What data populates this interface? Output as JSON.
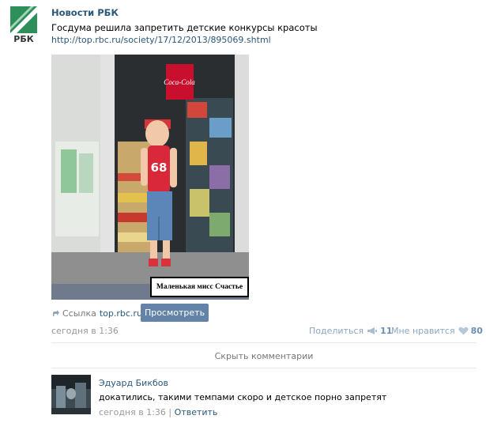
{
  "post": {
    "author": "Новости РБК",
    "logo_text": "РБК",
    "text": "Госдума решила запретить детские конкурсы красоты",
    "link": "http://top.rbc.ru/society/17/12/2013/895069.shtml",
    "photo_caption": "Маленькая мисс Счастье",
    "photo_sign": "Coca-Cola",
    "shirt_number": "68",
    "link_label": "Ссылка",
    "link_domain": "top.rbc.ru",
    "view_button": "Просмотреть",
    "time": "сегодня в 1:36",
    "share_label": "Поделиться",
    "share_count": "11",
    "like_label": "Мне нравится",
    "like_count": "80"
  },
  "comments": {
    "hide_label": "Скрыть комментарии",
    "items": [
      {
        "author": "Эдуард Бикбов",
        "text": "докатились, такими темпами скоро и детское порно запретят",
        "time": "сегодня в 1:36",
        "separator": "|",
        "reply": "Ответить"
      }
    ]
  },
  "colors": {
    "link": "#2b587a",
    "button": "#6383a8",
    "muted": "#999999",
    "logo_green": "#2e8b57"
  }
}
